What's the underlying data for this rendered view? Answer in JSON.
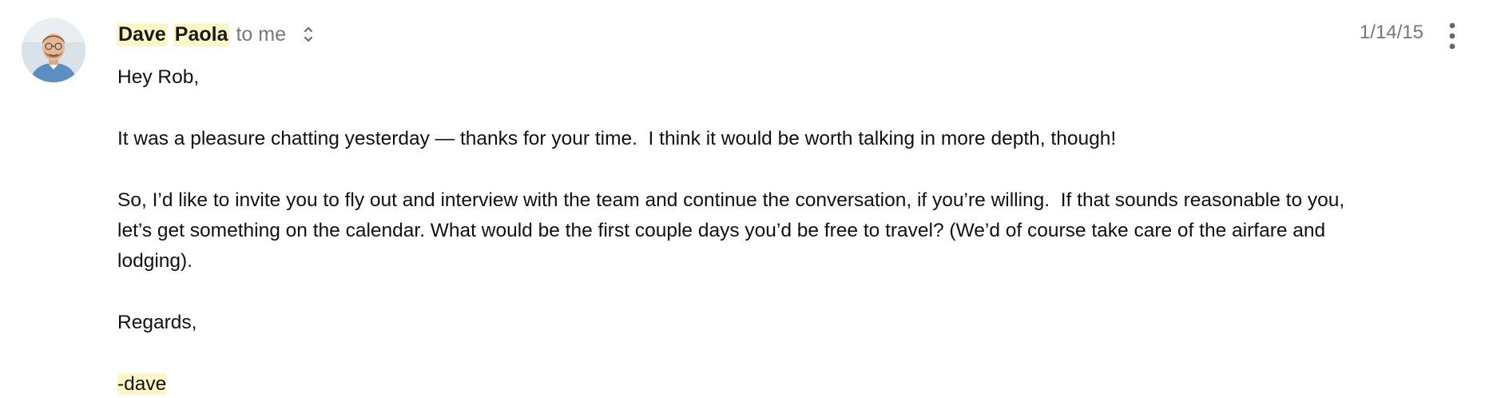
{
  "email": {
    "sender": {
      "first_name": "Dave",
      "last_name": "Paola"
    },
    "recipient_text": "to me",
    "date": "1/14/15",
    "icons": {
      "avatar": "sender-avatar-photo",
      "expand": "chevron-up-down-icon",
      "more": "vertical-dots-icon"
    },
    "body": {
      "greeting": "Hey Rob,",
      "paragraph_1": "It was a pleasure chatting yesterday — thanks for your time.  I think it would be worth talking in more depth, though!",
      "paragraph_2": "So, I’d like to invite you to fly out and interview with the team and continue the conversation, if you’re willing.  If that sounds reasonable to you, let’s get something on the calendar. What would be the first couple days you’d be free to travel? (We’d of course take care of the airfare and lodging).",
      "closing": "Regards,",
      "signature": "-dave"
    }
  }
}
